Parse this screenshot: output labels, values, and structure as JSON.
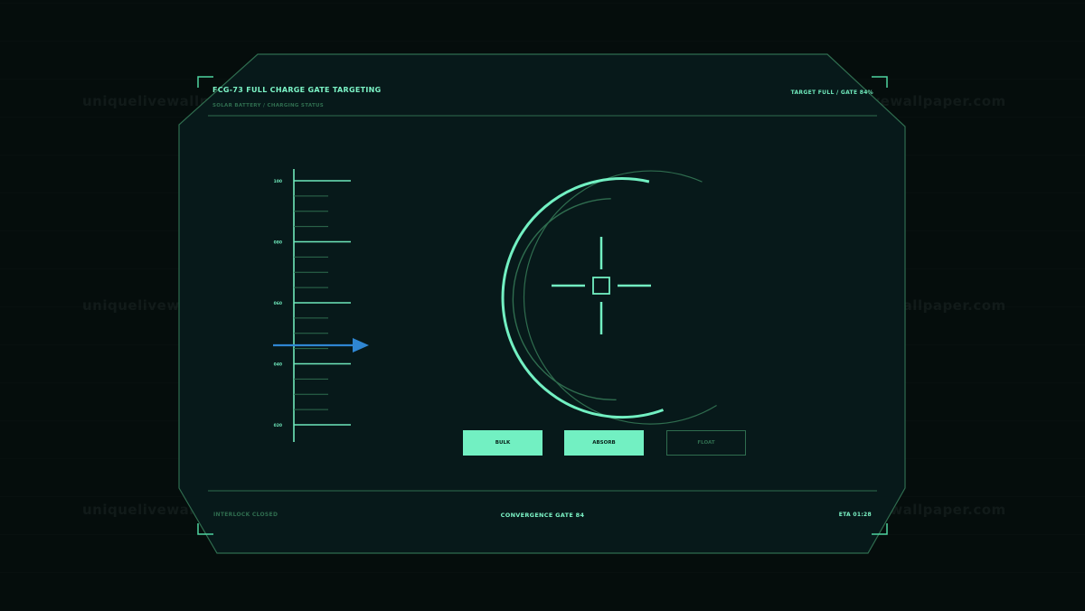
{
  "header": {
    "title": "FCG-73  FULL CHARGE GATE TARGETING",
    "subtitle": "SOLAR BATTERY / CHARGING STATUS",
    "status": "TARGET FULL  /  GATE 84%"
  },
  "gauge": {
    "tick_labels": [
      "100",
      "080",
      "060",
      "040",
      "020"
    ],
    "indicator_value": 46
  },
  "buttons": [
    {
      "label": "BULK",
      "state": "active"
    },
    {
      "label": "ABSORB",
      "state": "active"
    },
    {
      "label": "FLOAT",
      "state": "inactive"
    }
  ],
  "footer": {
    "left": "INTERLOCK CLOSED",
    "center": "CONVERGENCE GATE 84",
    "right": "ETA 01:28"
  },
  "watermark": "uniquelivewallpaper.com",
  "colors": {
    "accent": "#72f0c2",
    "dim": "#2f6d4f",
    "indicator": "#2f86d2",
    "panel": "#07191a"
  },
  "icons": {
    "crosshair": "crosshair-icon",
    "arrow": "arrow-right-icon"
  }
}
